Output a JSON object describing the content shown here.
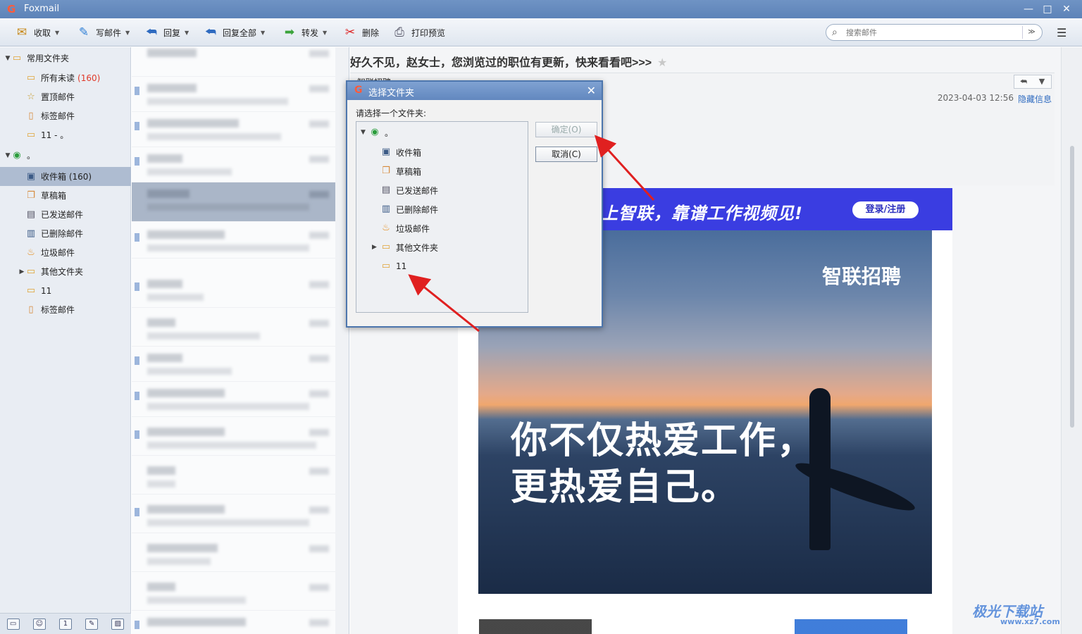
{
  "app": {
    "title": "Foxmail"
  },
  "toolbar": {
    "receive": "收取",
    "compose": "写邮件",
    "reply": "回复",
    "reply_all": "回复全部",
    "forward": "转发",
    "delete": "删除",
    "print_preview": "打印预览",
    "search_placeholder": "搜索邮件"
  },
  "sidebar": {
    "common_folders": "常用文件夹",
    "all_unread": "所有未读",
    "all_unread_count": "(160)",
    "pinned": "置顶邮件",
    "tagged": "标签邮件",
    "custom_folder": "11 - 。",
    "account": "。",
    "inbox": "收件箱 (160)",
    "drafts": "草稿箱",
    "sent": "已发送邮件",
    "deleted": "已删除邮件",
    "junk": "垃圾邮件",
    "other": "其他文件夹",
    "folder_11": "11",
    "tagged2": "标签邮件"
  },
  "reader": {
    "subject": "好久不见，赵女士，您浏览过的职位有更新，快来看看吧>>>",
    "from": "智联招聘",
    "date": "2023-04-03 12:56",
    "hide_info": "隐藏信息",
    "banner_slogan": "上智联，靠谱工作视频见!",
    "banner_login": "登录/注册",
    "brand": "智联招聘",
    "headline_1": "你不仅热爱工作，",
    "headline_2": "更热爱自己。"
  },
  "dialog": {
    "title": "选择文件夹",
    "prompt": "请选择一个文件夹:",
    "ok": "确定(O)",
    "cancel": "取消(C)",
    "tree": {
      "root": "。",
      "inbox": "收件箱",
      "drafts": "草稿箱",
      "sent": "已发送邮件",
      "deleted": "已删除邮件",
      "junk": "垃圾邮件",
      "other": "其他文件夹",
      "folder_11": "11"
    }
  },
  "watermark": {
    "text": "极光下载站",
    "url": "www.xz7.com"
  }
}
